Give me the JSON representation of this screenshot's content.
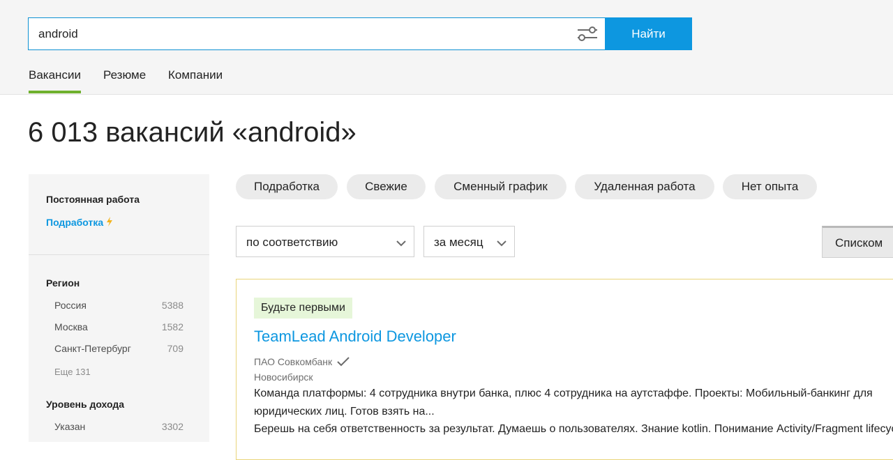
{
  "search": {
    "value": "android",
    "button_label": "Найти"
  },
  "tabs": [
    {
      "label": "Вакансии",
      "active": true
    },
    {
      "label": "Резюме",
      "active": false
    },
    {
      "label": "Компании",
      "active": false
    }
  ],
  "page_title": "6 013 вакансий «android»",
  "sidebar": {
    "employment_heading": "Постоянная работа",
    "parttime_link": "Подработка",
    "region_heading": "Регион",
    "regions": [
      {
        "name": "Россия",
        "count": "5388"
      },
      {
        "name": "Москва",
        "count": "1582"
      },
      {
        "name": "Санкт-Петербург",
        "count": "709"
      }
    ],
    "regions_more": "Еще 131",
    "income_heading": "Уровень дохода",
    "income": [
      {
        "name": "Указан",
        "count": "3302"
      }
    ]
  },
  "chips": [
    "Подработка",
    "Свежие",
    "Сменный график",
    "Удаленная работа",
    "Нет опыта"
  ],
  "sort": {
    "selected": "по соответствию"
  },
  "period": {
    "selected": "за месяц"
  },
  "view_toggle_label": "Списком",
  "vacancy": {
    "badge": "Будьте первыми",
    "title": "TeamLead Android Developer",
    "company": "ПАО Совкомбанк",
    "city": "Новосибирск",
    "desc_line1": "Команда платформы: 4 сотрудника внутри банка, плюс 4 сотрудника на аутстаффе. Проекты: Мобильный-банкинг для",
    "desc_line2": "юридических лиц. Готов взять на...",
    "desc_line3": "Берешь на себя ответственность за результат. Думаешь о пользователях. Знание kotlin. Понимание Activity/Fragment lifecycle."
  },
  "colors": {
    "accent": "#0d97e0",
    "active_tab_underline": "#6fb02d",
    "badge_bg": "#e6f6d9",
    "card_border": "#e9d57a"
  }
}
